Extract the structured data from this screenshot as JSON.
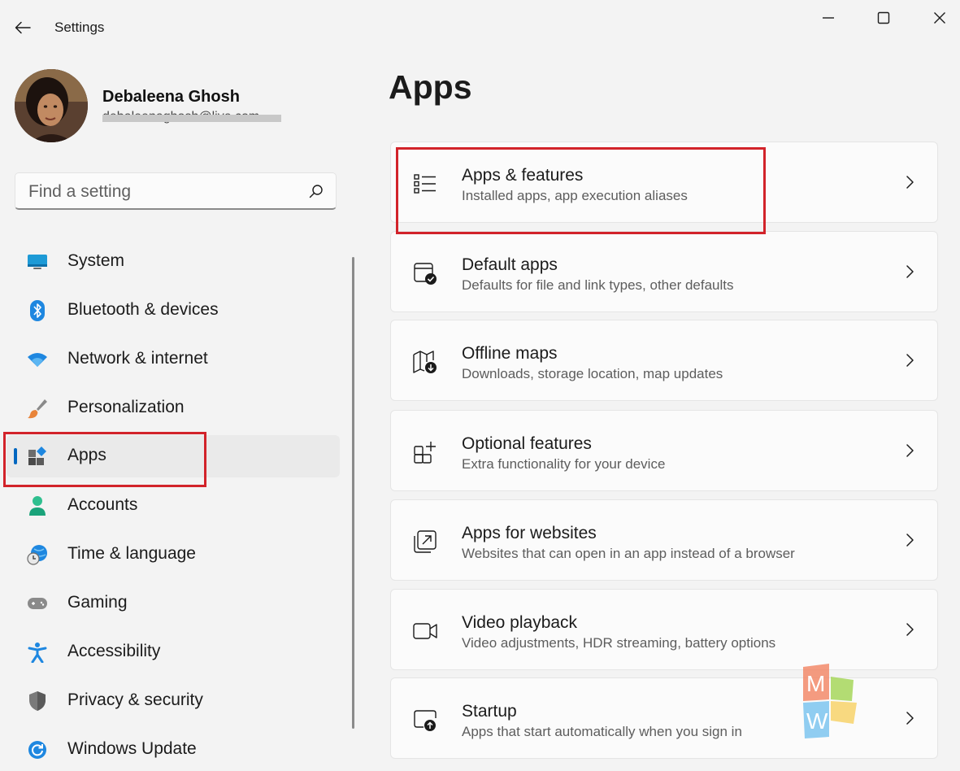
{
  "window": {
    "title": "Settings"
  },
  "profile": {
    "name": "Debaleena Ghosh",
    "email": "debaleenaghosh@live.com"
  },
  "search": {
    "placeholder": "Find a setting"
  },
  "nav": {
    "items": [
      {
        "label": "System",
        "icon": "system-icon"
      },
      {
        "label": "Bluetooth & devices",
        "icon": "bluetooth-icon"
      },
      {
        "label": "Network & internet",
        "icon": "wifi-icon"
      },
      {
        "label": "Personalization",
        "icon": "brush-icon"
      },
      {
        "label": "Apps",
        "icon": "apps-icon",
        "selected": true
      },
      {
        "label": "Accounts",
        "icon": "person-icon"
      },
      {
        "label": "Time & language",
        "icon": "globe-clock-icon"
      },
      {
        "label": "Gaming",
        "icon": "gamepad-icon"
      },
      {
        "label": "Accessibility",
        "icon": "accessibility-icon"
      },
      {
        "label": "Privacy & security",
        "icon": "shield-icon"
      },
      {
        "label": "Windows Update",
        "icon": "update-icon"
      }
    ]
  },
  "main": {
    "title": "Apps",
    "cards": [
      {
        "title": "Apps & features",
        "subtitle": "Installed apps, app execution aliases",
        "icon": "list-icon"
      },
      {
        "title": "Default apps",
        "subtitle": "Defaults for file and link types, other defaults",
        "icon": "default-apps-icon"
      },
      {
        "title": "Offline maps",
        "subtitle": "Downloads, storage location, map updates",
        "icon": "map-download-icon"
      },
      {
        "title": "Optional features",
        "subtitle": "Extra functionality for your device",
        "icon": "add-features-icon"
      },
      {
        "title": "Apps for websites",
        "subtitle": "Websites that can open in an app instead of a browser",
        "icon": "open-in-app-icon"
      },
      {
        "title": "Video playback",
        "subtitle": "Video adjustments, HDR streaming, battery options",
        "icon": "video-icon"
      },
      {
        "title": "Startup",
        "subtitle": "Apps that start automatically when you sign in",
        "icon": "startup-icon"
      }
    ]
  },
  "watermark": {
    "letters": [
      "M",
      "W"
    ]
  },
  "colors": {
    "accent": "#0067c0",
    "highlight": "#d2232a",
    "background": "#f3f3f3",
    "card": "#fbfbfb"
  }
}
